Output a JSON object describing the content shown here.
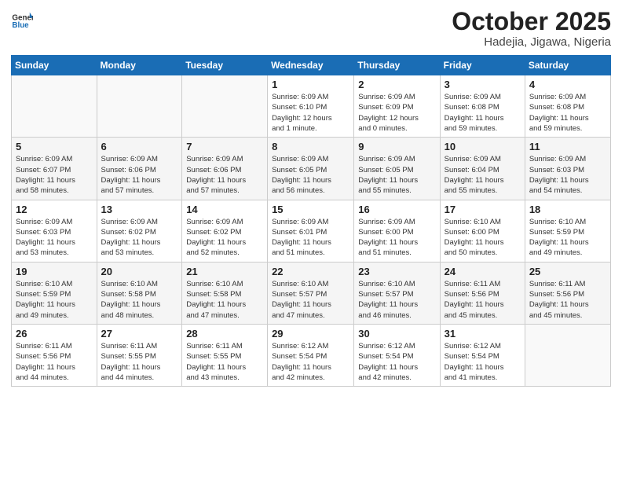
{
  "header": {
    "logo_general": "General",
    "logo_blue": "Blue",
    "title": "October 2025",
    "location": "Hadejia, Jigawa, Nigeria"
  },
  "weekdays": [
    "Sunday",
    "Monday",
    "Tuesday",
    "Wednesday",
    "Thursday",
    "Friday",
    "Saturday"
  ],
  "weeks": [
    {
      "days": [
        {
          "num": "",
          "info": ""
        },
        {
          "num": "",
          "info": ""
        },
        {
          "num": "",
          "info": ""
        },
        {
          "num": "1",
          "info": "Sunrise: 6:09 AM\nSunset: 6:10 PM\nDaylight: 12 hours\nand 1 minute."
        },
        {
          "num": "2",
          "info": "Sunrise: 6:09 AM\nSunset: 6:09 PM\nDaylight: 12 hours\nand 0 minutes."
        },
        {
          "num": "3",
          "info": "Sunrise: 6:09 AM\nSunset: 6:08 PM\nDaylight: 11 hours\nand 59 minutes."
        },
        {
          "num": "4",
          "info": "Sunrise: 6:09 AM\nSunset: 6:08 PM\nDaylight: 11 hours\nand 59 minutes."
        }
      ]
    },
    {
      "days": [
        {
          "num": "5",
          "info": "Sunrise: 6:09 AM\nSunset: 6:07 PM\nDaylight: 11 hours\nand 58 minutes."
        },
        {
          "num": "6",
          "info": "Sunrise: 6:09 AM\nSunset: 6:06 PM\nDaylight: 11 hours\nand 57 minutes."
        },
        {
          "num": "7",
          "info": "Sunrise: 6:09 AM\nSunset: 6:06 PM\nDaylight: 11 hours\nand 57 minutes."
        },
        {
          "num": "8",
          "info": "Sunrise: 6:09 AM\nSunset: 6:05 PM\nDaylight: 11 hours\nand 56 minutes."
        },
        {
          "num": "9",
          "info": "Sunrise: 6:09 AM\nSunset: 6:05 PM\nDaylight: 11 hours\nand 55 minutes."
        },
        {
          "num": "10",
          "info": "Sunrise: 6:09 AM\nSunset: 6:04 PM\nDaylight: 11 hours\nand 55 minutes."
        },
        {
          "num": "11",
          "info": "Sunrise: 6:09 AM\nSunset: 6:03 PM\nDaylight: 11 hours\nand 54 minutes."
        }
      ]
    },
    {
      "days": [
        {
          "num": "12",
          "info": "Sunrise: 6:09 AM\nSunset: 6:03 PM\nDaylight: 11 hours\nand 53 minutes."
        },
        {
          "num": "13",
          "info": "Sunrise: 6:09 AM\nSunset: 6:02 PM\nDaylight: 11 hours\nand 53 minutes."
        },
        {
          "num": "14",
          "info": "Sunrise: 6:09 AM\nSunset: 6:02 PM\nDaylight: 11 hours\nand 52 minutes."
        },
        {
          "num": "15",
          "info": "Sunrise: 6:09 AM\nSunset: 6:01 PM\nDaylight: 11 hours\nand 51 minutes."
        },
        {
          "num": "16",
          "info": "Sunrise: 6:09 AM\nSunset: 6:00 PM\nDaylight: 11 hours\nand 51 minutes."
        },
        {
          "num": "17",
          "info": "Sunrise: 6:10 AM\nSunset: 6:00 PM\nDaylight: 11 hours\nand 50 minutes."
        },
        {
          "num": "18",
          "info": "Sunrise: 6:10 AM\nSunset: 5:59 PM\nDaylight: 11 hours\nand 49 minutes."
        }
      ]
    },
    {
      "days": [
        {
          "num": "19",
          "info": "Sunrise: 6:10 AM\nSunset: 5:59 PM\nDaylight: 11 hours\nand 49 minutes."
        },
        {
          "num": "20",
          "info": "Sunrise: 6:10 AM\nSunset: 5:58 PM\nDaylight: 11 hours\nand 48 minutes."
        },
        {
          "num": "21",
          "info": "Sunrise: 6:10 AM\nSunset: 5:58 PM\nDaylight: 11 hours\nand 47 minutes."
        },
        {
          "num": "22",
          "info": "Sunrise: 6:10 AM\nSunset: 5:57 PM\nDaylight: 11 hours\nand 47 minutes."
        },
        {
          "num": "23",
          "info": "Sunrise: 6:10 AM\nSunset: 5:57 PM\nDaylight: 11 hours\nand 46 minutes."
        },
        {
          "num": "24",
          "info": "Sunrise: 6:11 AM\nSunset: 5:56 PM\nDaylight: 11 hours\nand 45 minutes."
        },
        {
          "num": "25",
          "info": "Sunrise: 6:11 AM\nSunset: 5:56 PM\nDaylight: 11 hours\nand 45 minutes."
        }
      ]
    },
    {
      "days": [
        {
          "num": "26",
          "info": "Sunrise: 6:11 AM\nSunset: 5:56 PM\nDaylight: 11 hours\nand 44 minutes."
        },
        {
          "num": "27",
          "info": "Sunrise: 6:11 AM\nSunset: 5:55 PM\nDaylight: 11 hours\nand 44 minutes."
        },
        {
          "num": "28",
          "info": "Sunrise: 6:11 AM\nSunset: 5:55 PM\nDaylight: 11 hours\nand 43 minutes."
        },
        {
          "num": "29",
          "info": "Sunrise: 6:12 AM\nSunset: 5:54 PM\nDaylight: 11 hours\nand 42 minutes."
        },
        {
          "num": "30",
          "info": "Sunrise: 6:12 AM\nSunset: 5:54 PM\nDaylight: 11 hours\nand 42 minutes."
        },
        {
          "num": "31",
          "info": "Sunrise: 6:12 AM\nSunset: 5:54 PM\nDaylight: 11 hours\nand 41 minutes."
        },
        {
          "num": "",
          "info": ""
        }
      ]
    }
  ]
}
